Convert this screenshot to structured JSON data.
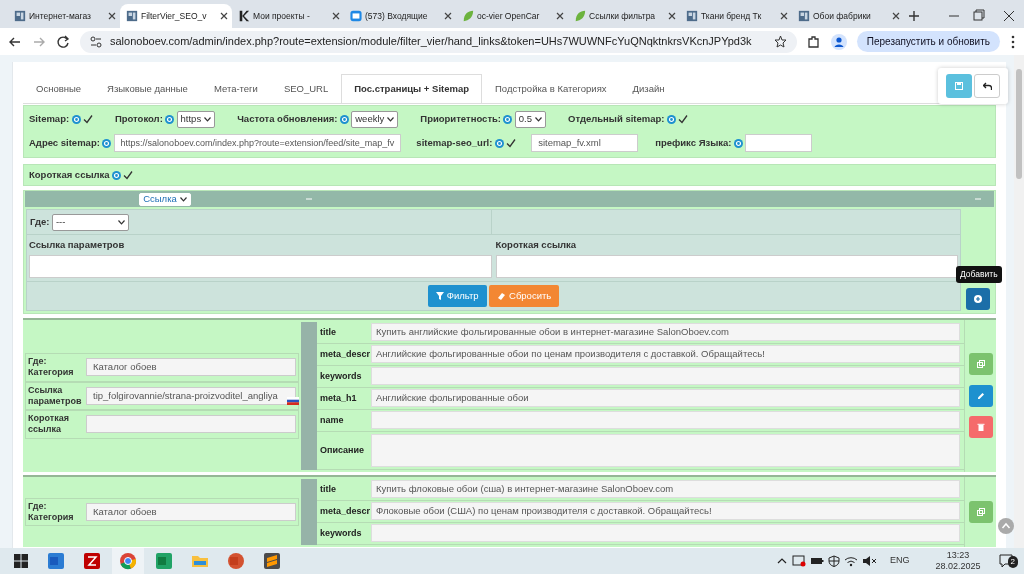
{
  "browser": {
    "tabs": [
      {
        "title": "Интернет-магаз",
        "kind": "page",
        "selected": false
      },
      {
        "title": "FilterVier_SEO_v",
        "kind": "page",
        "selected": true
      },
      {
        "title": "Мои проекты -",
        "kind": "k",
        "selected": false
      },
      {
        "title": "(573) Входящие",
        "kind": "mail",
        "selected": false
      },
      {
        "title": "oc-vier OpenCar",
        "kind": "leaf",
        "selected": false
      },
      {
        "title": "Ссылки фильтра",
        "kind": "leaf",
        "selected": false
      },
      {
        "title": "Ткани бренд Тк",
        "kind": "page",
        "selected": false
      },
      {
        "title": "Обои фабрики",
        "kind": "page",
        "selected": false
      }
    ],
    "url": "salonoboev.com/admin/index.php?route=extension/module/filter_vier/hand_links&token=UHs7WUWNFcYuQNqktnkrsVKcnJPYpd3k",
    "relaunch": "Перезапустить и обновить"
  },
  "admin_tabs": [
    {
      "label": "Основные",
      "selected": false
    },
    {
      "label": "Языковые данные",
      "selected": false
    },
    {
      "label": "Мета-теги",
      "selected": false
    },
    {
      "label": "SEO_URL",
      "selected": false
    },
    {
      "label": "Пос.страницы + Sitemap",
      "selected": true
    },
    {
      "label": "Подстройка в Категориях",
      "selected": false
    },
    {
      "label": "Дизайн",
      "selected": false
    }
  ],
  "settings": {
    "row1": [
      {
        "kind": "check",
        "label": "Sitemap:",
        "checked": true
      },
      {
        "kind": "select",
        "label": "Протокол:",
        "value": "https"
      },
      {
        "kind": "select",
        "label": "Частота обновления:",
        "value": "weekly"
      },
      {
        "kind": "select",
        "label": "Приоритетность:",
        "value": "0.5"
      },
      {
        "kind": "check",
        "label": "Отдельный sitemap:",
        "checked": true
      }
    ],
    "row2": [
      {
        "kind": "input",
        "label": "Адрес sitemap:",
        "value": "https://salonoboev.com/index.php?route=extension/feed/site_map_fv"
      },
      {
        "kind": "check",
        "label": "sitemap-seo_url:",
        "checked": true
      },
      {
        "kind": "input",
        "value": "sitemap_fv.xml"
      },
      {
        "kind": "input",
        "label": "префикс Языка:"
      }
    ],
    "short_link": {
      "label": "Короткая ссылка",
      "checked": true
    }
  },
  "filter": {
    "column_select": "Ссылка",
    "where_label": "Где:",
    "where_value": "---",
    "param_label": "Ссылка параметров",
    "short_label": "Короткая ссылка",
    "filter_button": "Фильтр",
    "reset_button": "Сбросить",
    "add_tooltip": "Добавить"
  },
  "records": [
    {
      "fields": [
        {
          "label": "Где: Категория",
          "value": "Каталог обоев"
        },
        {
          "label": "Ссылка параметров",
          "value": "tip_folgirovannie/strana-proizvoditel_angliya"
        },
        {
          "label": "Короткая ссылка"
        }
      ],
      "meta": [
        {
          "label": "title",
          "value": "Купить английские фольгированные обои в интернет-магазине SalonOboev.com"
        },
        {
          "label": "meta_descr",
          "value": "Английские фольгированные обои по ценам производителя с доставкой. Обращайтесь!"
        },
        {
          "label": "keywords"
        },
        {
          "label": "meta_h1",
          "value": "Английские фольгированные обои"
        },
        {
          "label": "name"
        },
        {
          "label": "Описание",
          "kind": "textarea"
        }
      ],
      "actions": [
        {
          "kind": "copy"
        },
        {
          "kind": "edit"
        },
        {
          "kind": "delete"
        }
      ]
    },
    {
      "fields": [
        {
          "label": "Где: Категория",
          "value": "Каталог обоев"
        }
      ],
      "meta": [
        {
          "label": "title",
          "value": "Купить флоковые обои (сша) в интернет-магазине SalonOboev.com"
        },
        {
          "label": "meta_descr",
          "value": "Флоковые обои (США) по ценам производителя с доставкой. Обращайтесь!"
        },
        {
          "label": "keywords"
        }
      ],
      "actions": [
        {
          "kind": "copy"
        }
      ]
    }
  ],
  "taskbar": {
    "apps": [
      {
        "kind": "word"
      },
      {
        "kind": "filezilla"
      },
      {
        "kind": "chrome"
      },
      {
        "kind": "excel"
      },
      {
        "kind": "folder"
      },
      {
        "kind": "powerpoint"
      },
      {
        "kind": "sublime"
      }
    ],
    "language": "ENG",
    "time": "13:23",
    "date": "28.02.2025",
    "notifications": "2"
  }
}
